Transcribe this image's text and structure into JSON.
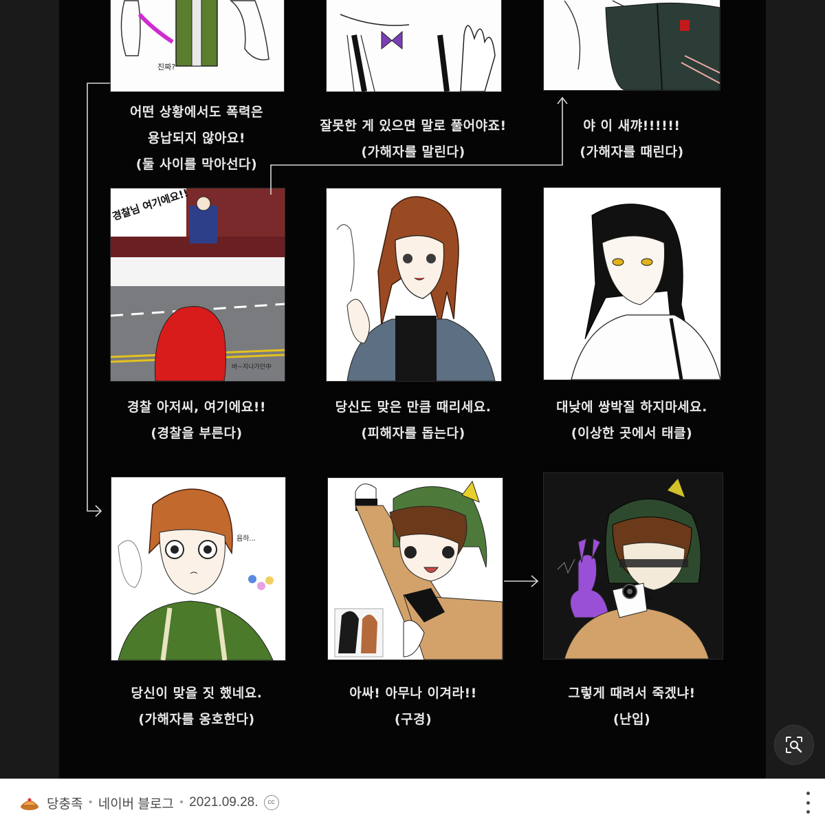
{
  "captions": [
    {
      "line1": "어떤 상황에서도 폭력은",
      "line2": "용납되지 않아요!",
      "line3": "(둘 사이를 막아선다)"
    },
    {
      "line1": "잘못한 게 있으면 말로 풀어야죠!",
      "line2": "(가해자를 말린다)"
    },
    {
      "line1": "야 이 새꺄!!!!!!",
      "line2": "(가해자를 때린다)"
    },
    {
      "line1": "경찰 아저씨, 여기에요!!",
      "line2": "(경찰을 부른다)"
    },
    {
      "line1": "당신도 맞은 만큼 때리세요.",
      "line2": "(피해자를 돕는다)"
    },
    {
      "line1": "대낮에 쌍박질 하지마세요.",
      "line2": "(이상한 곳에서 태클)"
    },
    {
      "line1": "당신이 맞을 짓 했네요.",
      "line2": "(가해자를 옹호한다)"
    },
    {
      "line1": "아싸! 아무나 이겨라!!",
      "line2": "(구경)"
    },
    {
      "line1": "그렇게 때려서 죽겠냐!",
      "line2": "(난입)"
    }
  ],
  "panel_texts": {
    "p1": "진짜?",
    "p4_shout": "경찰님 여기에요!!",
    "p4_sign": "바~지나가던中",
    "p7": "음하..."
  },
  "footer": {
    "source_name": "당충족",
    "source_type": "네이버 블로그",
    "date": "2021.09.28.",
    "cc": "cc"
  },
  "icons": {
    "source": "tart-icon",
    "lens": "image-search-icon",
    "more": "more-vertical-icon",
    "license": "creative-commons-icon"
  },
  "colors": {
    "comic_background": "#050505",
    "caption_text": "#e9e9e9",
    "footer_background": "#ffffff",
    "footer_text": "#4a4a4a"
  }
}
